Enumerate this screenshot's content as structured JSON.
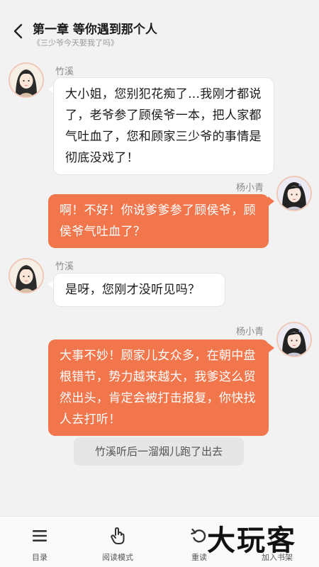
{
  "header": {
    "title": "第一章 等你遇到那个人",
    "subtitle": "《三少爷今天娶我了吗》"
  },
  "messages": [
    {
      "speaker": "竹溪",
      "side": "left",
      "text": "大小姐，您别犯花痴了…我刚才都说了，老爷参了顾侯爷一本，把人家都气吐血了，您和顾家三少爷的事情是彻底没戏了！"
    },
    {
      "speaker": "杨小青",
      "side": "right",
      "text": "啊！不好！你说爹爹参了顾侯爷，顾侯爷气吐血了？"
    },
    {
      "speaker": "竹溪",
      "side": "left",
      "text": "是呀，您刚才没听见吗？"
    },
    {
      "speaker": "杨小青",
      "side": "right",
      "text": "大事不妙！顾家儿女众多，在朝中盘根错节，势力越来越大，我爹这么贸然出头，肯定会被打击报复，你快找人去打听！"
    }
  ],
  "narration": "竹溪听后一溜烟儿跑了出去",
  "toolbar": {
    "catalog": "目录",
    "read_mode": "阅读模式",
    "reread": "重读",
    "add_shelf": "加入书架"
  },
  "watermark": "大玩客",
  "colors": {
    "accent": "#f2764c",
    "background": "#f2f2f2"
  }
}
